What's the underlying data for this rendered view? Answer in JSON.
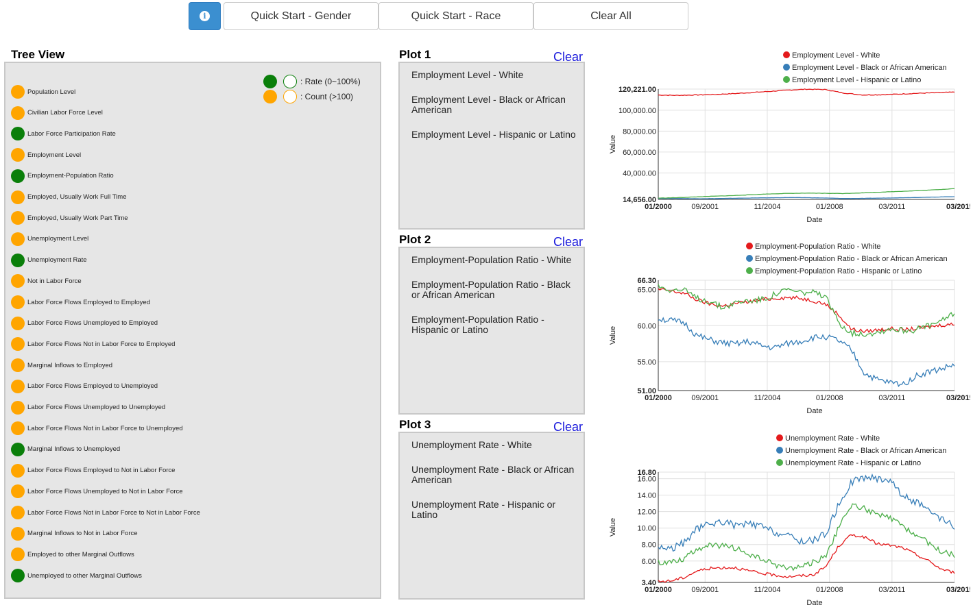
{
  "toolbar": {
    "info_icon": "i",
    "quick_gender": "Quick Start - Gender",
    "quick_race": "Quick Start - Race",
    "clear_all": "Clear All"
  },
  "tree": {
    "title": "Tree View",
    "legend": {
      "rate": ": Rate (0~100%)",
      "count": ": Count (>100)"
    },
    "items": [
      {
        "label": "Population Level",
        "type": "count"
      },
      {
        "label": "Civilian Labor Force Level",
        "type": "count"
      },
      {
        "label": "Labor Force Participation Rate",
        "type": "rate"
      },
      {
        "label": "Employment Level",
        "type": "count"
      },
      {
        "label": "Employment-Population Ratio",
        "type": "rate"
      },
      {
        "label": "Employed, Usually Work Full Time",
        "type": "count"
      },
      {
        "label": "Employed, Usually Work Part Time",
        "type": "count"
      },
      {
        "label": "Unemployment Level",
        "type": "count"
      },
      {
        "label": "Unemployment Rate",
        "type": "rate"
      },
      {
        "label": "Not in Labor Force",
        "type": "count"
      },
      {
        "label": "Labor Force Flows Employed to Employed",
        "type": "count"
      },
      {
        "label": "Labor Force Flows Unemployed to Employed",
        "type": "count"
      },
      {
        "label": "Labor Force Flows Not in Labor Force to Employed",
        "type": "count"
      },
      {
        "label": "Marginal Inflows to Employed",
        "type": "count"
      },
      {
        "label": "Labor Force Flows Employed to Unemployed",
        "type": "count"
      },
      {
        "label": "Labor Force Flows Unemployed to Unemployed",
        "type": "count"
      },
      {
        "label": "Labor Force Flows Not in Labor Force to Unemployed",
        "type": "count"
      },
      {
        "label": "Marginal Inflows to Unemployed",
        "type": "rate"
      },
      {
        "label": "Labor Force Flows Employed to Not in Labor Force",
        "type": "count"
      },
      {
        "label": "Labor Force Flows Unemployed to Not in Labor Force",
        "type": "count"
      },
      {
        "label": "Labor Force Flows Not in Labor Force to Not in Labor Force",
        "type": "count"
      },
      {
        "label": "Marginal Inflows to Not in Labor Force",
        "type": "count"
      },
      {
        "label": "Employed to other Marginal Outflows",
        "type": "count"
      },
      {
        "label": "Unemployed to other Marginal Outflows",
        "type": "rate"
      }
    ]
  },
  "plots": [
    {
      "title": "Plot 1",
      "clear": "Clear",
      "items": [
        "Employment Level - White",
        "Employment Level - Black or African American",
        "Employment Level - Hispanic or Latino"
      ]
    },
    {
      "title": "Plot 2",
      "clear": "Clear",
      "items": [
        "Employment-Population Ratio - White",
        "Employment-Population Ratio - Black or African American",
        "Employment-Population Ratio - Hispanic or Latino"
      ]
    },
    {
      "title": "Plot 3",
      "clear": "Clear",
      "items": [
        "Unemployment Rate - White",
        "Unemployment Rate - Black or African American",
        "Unemployment Rate - Hispanic or Latino"
      ]
    }
  ],
  "colors": {
    "white": "#e41a1c",
    "black": "#377eb8",
    "hispanic": "#4daf4a",
    "count": "#ffa500",
    "rate": "#0a7f0a"
  },
  "chart_data": [
    {
      "type": "line",
      "xlabel": "Date",
      "ylabel": "Value",
      "xticks": [
        "01/2000",
        "09/2001",
        "11/2004",
        "01/2008",
        "03/2011",
        "03/2015"
      ],
      "yticks": [
        "14,656.00",
        "40,000.00",
        "60,000.00",
        "80,000.00",
        "100,000.00",
        "120,221.00"
      ],
      "ylim": [
        14656,
        120221
      ],
      "series": [
        {
          "name": "Employment Level - White",
          "values": [
            114500,
            114200,
            114600,
            115000,
            115800,
            116900,
            118000,
            119200,
            120100,
            119800,
            116500,
            114600,
            114800,
            115400,
            116200,
            116700,
            117300
          ]
        },
        {
          "name": "Employment Level - Black or African American",
          "values": [
            15600,
            15500,
            15300,
            15400,
            15700,
            16000,
            16200,
            16400,
            16300,
            16000,
            15500,
            15600,
            15900,
            16200,
            16500,
            16900,
            17300
          ]
        },
        {
          "name": "Employment Level - Hispanic or Latino",
          "values": [
            15900,
            16300,
            17000,
            17700,
            18300,
            19100,
            19900,
            20400,
            20600,
            20500,
            20300,
            20900,
            21600,
            22300,
            23000,
            23900,
            25000
          ]
        }
      ]
    },
    {
      "type": "line",
      "xlabel": "Date",
      "ylabel": "Value",
      "xticks": [
        "01/2000",
        "09/2001",
        "11/2004",
        "01/2008",
        "03/2011",
        "03/2015"
      ],
      "yticks": [
        "51.00",
        "55.00",
        "60.00",
        "65.00",
        "66.30"
      ],
      "ylim": [
        51,
        66.3
      ],
      "series": [
        {
          "name": "Employment-Population Ratio - White",
          "values": [
            65.0,
            64.8,
            64.5,
            63.6,
            63.0,
            62.7,
            63.1,
            63.3,
            63.6,
            63.8,
            63.9,
            63.8,
            63.5,
            63.0,
            61.5,
            59.5,
            59.2,
            59.4,
            59.6,
            59.4,
            59.6,
            59.8,
            60.1,
            60.2
          ]
        },
        {
          "name": "Employment-Population Ratio - Black or African American",
          "values": [
            61.0,
            60.7,
            60.4,
            58.6,
            58.0,
            57.6,
            57.4,
            57.8,
            57.2,
            56.9,
            57.5,
            57.8,
            58.3,
            58.5,
            57.9,
            56.6,
            53.4,
            52.5,
            52.1,
            51.9,
            53.0,
            53.6,
            54.0,
            54.6
          ]
        },
        {
          "name": "Employment-Population Ratio - Hispanic or Latino",
          "values": [
            65.5,
            65.0,
            64.9,
            63.8,
            63.4,
            62.5,
            63.2,
            63.5,
            63.6,
            64.3,
            65.0,
            64.6,
            64.6,
            63.9,
            60.5,
            59.0,
            58.9,
            59.1,
            59.6,
            59.4,
            59.4,
            60.0,
            60.6,
            61.9
          ]
        }
      ]
    },
    {
      "type": "line",
      "xlabel": "Date",
      "ylabel": "Value",
      "xticks": [
        "01/2000",
        "09/2001",
        "11/2004",
        "01/2008",
        "03/2011",
        "03/2015"
      ],
      "yticks": [
        "3.40",
        "6.00",
        "8.00",
        "10.00",
        "12.00",
        "14.00",
        "16.00",
        "16.80"
      ],
      "ylim": [
        3.4,
        16.8
      ],
      "series": [
        {
          "name": "Unemployment Rate - White",
          "values": [
            3.5,
            3.6,
            4.0,
            4.8,
            5.1,
            5.2,
            5.2,
            4.8,
            4.5,
            4.3,
            4.1,
            4.2,
            4.3,
            5.3,
            7.8,
            9.2,
            8.9,
            8.1,
            7.9,
            7.6,
            6.8,
            6.0,
            5.0,
            4.6
          ]
        },
        {
          "name": "Unemployment Rate - Black or African American",
          "values": [
            7.7,
            7.5,
            8.2,
            9.9,
            10.5,
            10.8,
            10.3,
            10.5,
            10.2,
            9.5,
            9.1,
            8.4,
            8.5,
            9.3,
            12.8,
            15.6,
            16.2,
            16.0,
            15.9,
            13.9,
            13.2,
            12.0,
            11.0,
            10.2
          ]
        },
        {
          "name": "Unemployment Rate - Hispanic or Latino",
          "values": [
            5.8,
            5.9,
            6.3,
            7.5,
            7.9,
            7.8,
            7.6,
            6.8,
            6.2,
            5.6,
            5.1,
            5.3,
            5.8,
            6.6,
            10.0,
            12.8,
            12.4,
            11.6,
            11.2,
            10.2,
            9.2,
            8.2,
            7.1,
            6.7
          ]
        }
      ]
    }
  ]
}
